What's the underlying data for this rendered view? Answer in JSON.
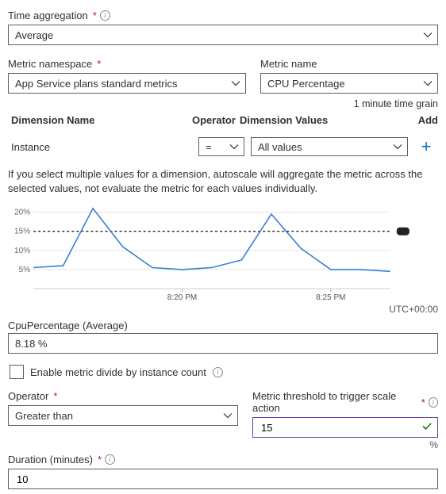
{
  "time_aggregation": {
    "label": "Time aggregation",
    "value": "Average"
  },
  "metric_namespace": {
    "label": "Metric namespace",
    "value": "App Service plans standard metrics"
  },
  "metric_name": {
    "label": "Metric name",
    "value": "CPU Percentage"
  },
  "time_grain": "1 minute time grain",
  "dim_header": {
    "name": "Dimension Name",
    "op": "Operator",
    "vals": "Dimension Values",
    "add": "Add"
  },
  "dim_row": {
    "name": "Instance",
    "op": "=",
    "vals": "All values"
  },
  "help": "If you select multiple values for a dimension, autoscale will aggregate the metric across the selected values, not evaluate the metric for each values individually.",
  "chart_data": {
    "type": "line",
    "x_labels": [
      "8:20 PM",
      "8:25 PM"
    ],
    "x_label_positions": [
      5,
      10
    ],
    "ylim": [
      0,
      22
    ],
    "y_ticks": [
      5,
      10,
      15,
      20
    ],
    "threshold": 15,
    "timezone": "UTC+00:00",
    "series": [
      {
        "name": "CpuPercentage",
        "values": [
          5.5,
          6.0,
          21.0,
          11.0,
          5.5,
          5.0,
          5.5,
          7.5,
          19.5,
          10.5,
          5.0,
          5.0,
          4.5
        ]
      }
    ]
  },
  "current": {
    "label": "CpuPercentage (Average)",
    "value": "8.18 %"
  },
  "divide_cb": "Enable metric divide by instance count",
  "operator": {
    "label": "Operator",
    "value": "Greater than"
  },
  "threshold": {
    "label": "Metric threshold to trigger scale action",
    "value": "15",
    "unit": "%"
  },
  "duration": {
    "label": "Duration (minutes)",
    "value": "10"
  }
}
